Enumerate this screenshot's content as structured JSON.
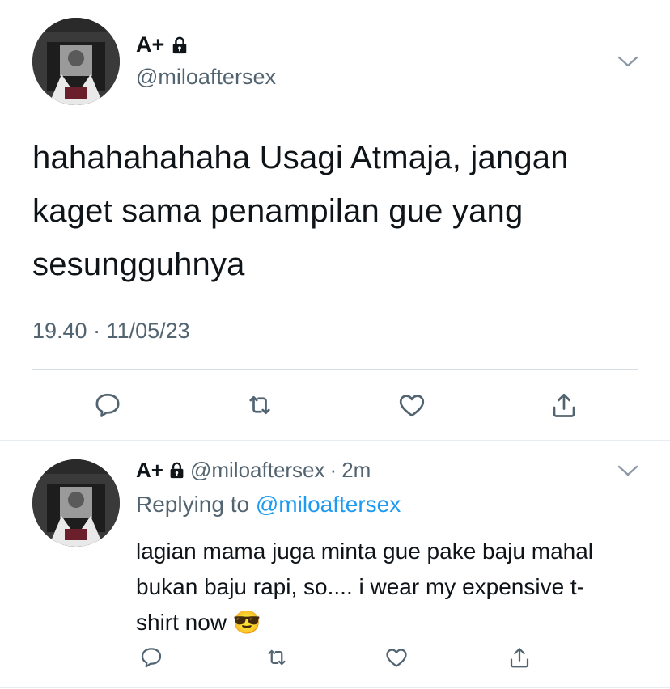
{
  "tweet": {
    "display_name": "A+",
    "handle": "@miloaftersex",
    "text": "hahahahahaha Usagi Atmaja, jangan kaget sama penampilan gue yang sesungguhnya",
    "timestamp": "19.40 · 11/05/23",
    "icons": [
      "lock-icon",
      "chevron-down-icon",
      "reply-icon",
      "retweet-icon",
      "like-icon",
      "share-icon"
    ]
  },
  "reply": {
    "display_name": "A+",
    "handle": "@miloaftersex",
    "separator": "·",
    "time": "2m",
    "replying_to_prefix": "Replying to ",
    "replying_to_handle": "@miloaftersex",
    "text": "lagian mama juga minta gue pake baju mahal bukan baju rapi, so.... i wear my expensive t-shirt now",
    "emoji": "😎"
  },
  "colors": {
    "text": "#0f1419",
    "secondary": "#536471",
    "link": "#1d9bf0",
    "divider": "#d9dee2"
  }
}
